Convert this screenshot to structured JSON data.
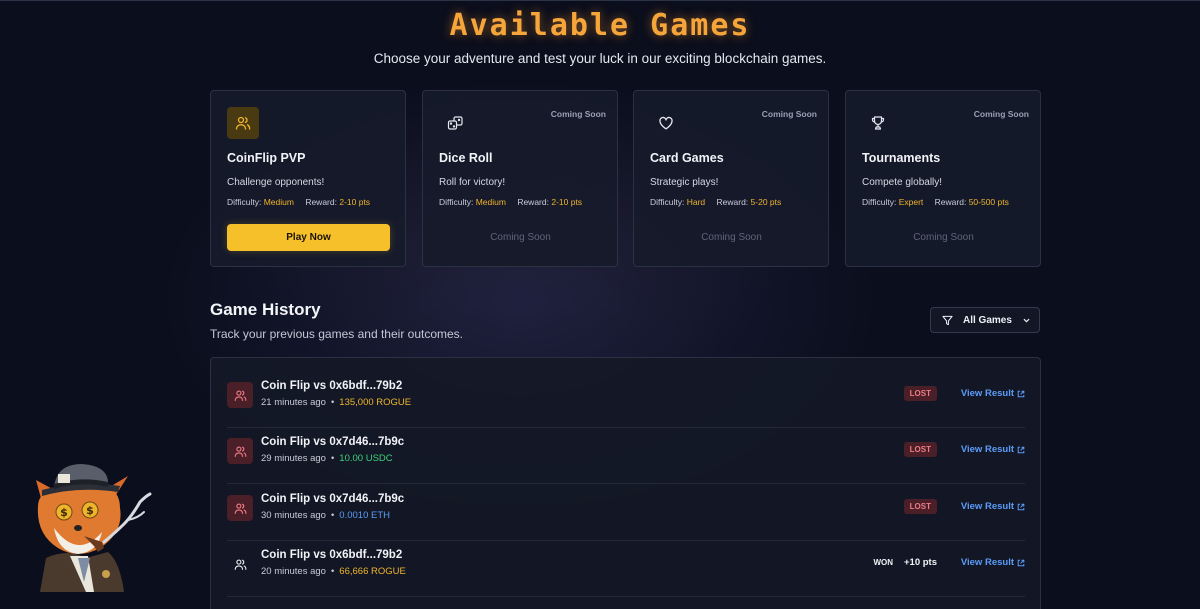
{
  "header": {
    "title": "Available Games",
    "subtitle": "Choose your adventure and test your luck in our exciting blockchain games."
  },
  "cards": [
    {
      "icon": "users-icon",
      "badge": "",
      "title": "CoinFlip PVP",
      "desc": "Challenge opponents!",
      "difficulty_label": "Difficulty:",
      "difficulty": "Medium",
      "reward_label": "Reward:",
      "reward": "2-10 pts",
      "action": "Play Now"
    },
    {
      "icon": "dice-icon",
      "badge": "Coming Soon",
      "title": "Dice Roll",
      "desc": "Roll for victory!",
      "difficulty_label": "Difficulty:",
      "difficulty": "Medium",
      "reward_label": "Reward:",
      "reward": "2-10 pts",
      "action": "Coming Soon"
    },
    {
      "icon": "heart-icon",
      "badge": "Coming Soon",
      "title": "Card Games",
      "desc": "Strategic plays!",
      "difficulty_label": "Difficulty:",
      "difficulty": "Hard",
      "reward_label": "Reward:",
      "reward": "5-20 pts",
      "action": "Coming Soon"
    },
    {
      "icon": "trophy-icon",
      "badge": "Coming Soon",
      "title": "Tournaments",
      "desc": "Compete globally!",
      "difficulty_label": "Difficulty:",
      "difficulty": "Expert",
      "reward_label": "Reward:",
      "reward": "50-500 pts",
      "action": "Coming Soon"
    }
  ],
  "history": {
    "title": "Game History",
    "subtitle": "Track your previous games and their outcomes.",
    "filter_label": "All Games",
    "view_label": "View Result",
    "rows": [
      {
        "title": "Coin Flip vs 0x6bdf...79b2",
        "time": "21 minutes ago",
        "amount": "135,000 ROGUE",
        "status": "LOST",
        "points": ""
      },
      {
        "title": "Coin Flip vs 0x7d46...7b9c",
        "time": "29 minutes ago",
        "amount": "10.00 USDC",
        "status": "LOST",
        "points": ""
      },
      {
        "title": "Coin Flip vs 0x7d46...7b9c",
        "time": "30 minutes ago",
        "amount": "0.0010 ETH",
        "status": "LOST",
        "points": ""
      },
      {
        "title": "Coin Flip vs 0x6bdf...79b2",
        "time": "20 minutes ago",
        "amount": "66,666 ROGUE",
        "status": "WON",
        "points": "+10 pts"
      }
    ]
  },
  "colors": {
    "title_orange": "#f6a53a",
    "accent_gold": "#f5c02a",
    "lost_red": "#f07a85",
    "link_blue": "#5b9cf6",
    "usdc_green": "#3ed27a"
  }
}
